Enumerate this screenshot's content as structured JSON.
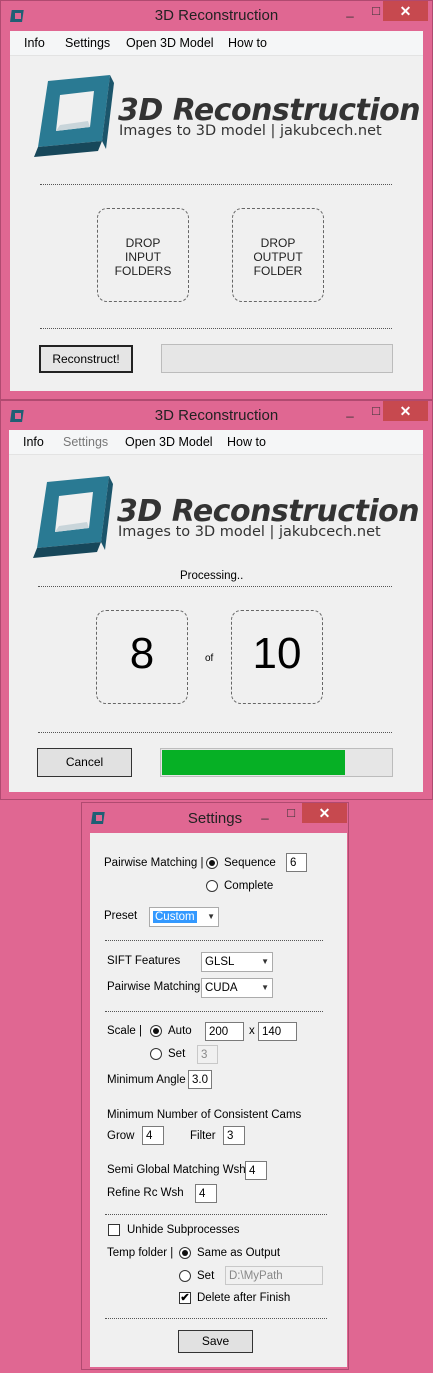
{
  "win1": {
    "title": "3D Reconstruction",
    "menu": [
      "Info",
      "Settings",
      "Open 3D Model",
      "How to"
    ],
    "logo_title": "3D Reconstruction",
    "logo_subtitle": "Images to 3D model | jakubcech.net",
    "drop_input": [
      "DROP",
      "INPUT",
      "FOLDERS"
    ],
    "drop_output": [
      "DROP",
      "OUTPUT",
      "FOLDER"
    ],
    "reconstruct_label": "Reconstruct!",
    "progress": 0
  },
  "win2": {
    "title": "3D Reconstruction",
    "menu": [
      "Info",
      "Settings",
      "Open 3D Model",
      "How to"
    ],
    "logo_title": "3D Reconstruction",
    "logo_subtitle": "Images to 3D model | jakubcech.net",
    "status": "Processing..",
    "current": "8",
    "of_label": "of",
    "total": "10",
    "cancel_label": "Cancel",
    "progress": 0.8
  },
  "settings": {
    "title": "Settings",
    "pairwise_label": "Pairwise Matching |",
    "sequence_label": "Sequence",
    "sequence_value": "6",
    "complete_label": "Complete",
    "preset_label": "Preset",
    "preset_value": "Custom",
    "sift_label": "SIFT Features",
    "sift_value": "GLSL",
    "pm_label": "Pairwise Matching",
    "pm_value": "CUDA",
    "scale_label": "Scale |",
    "auto_label": "Auto",
    "scale_w": "200",
    "x_label": "x",
    "scale_h": "140",
    "set_label": "Set",
    "set_value": "3",
    "min_angle_label": "Minimum Angle",
    "min_angle_value": "3.0",
    "min_cams_label": "Minimum Number of Consistent Cams",
    "grow_label": "Grow",
    "grow_value": "4",
    "filter_label": "Filter",
    "filter_value": "3",
    "sgm_label": "Semi Global Matching Wsh",
    "sgm_value": "4",
    "refine_label": "Refine Rc Wsh",
    "refine_value": "4",
    "unhide_label": "Unhide Subprocesses",
    "temp_label": "Temp folder |",
    "same_output_label": "Same as Output",
    "temp_set_label": "Set",
    "temp_path": "D:\\MyPath",
    "delete_label": "Delete after Finish",
    "delete_checkmark": "✔",
    "save_label": "Save"
  },
  "titlebar": {
    "min": "_",
    "max": "□",
    "close": "✕"
  },
  "colors": {
    "accent_bg": "#e06792",
    "progress_fill": "#06b025",
    "logo_teal": "#1f5f74"
  }
}
